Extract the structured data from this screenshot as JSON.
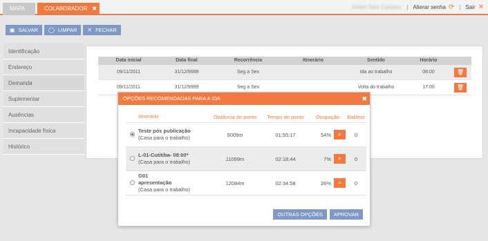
{
  "tabs": [
    {
      "label": "MAPA"
    },
    {
      "label": "COLABORADOR",
      "close": "✖"
    }
  ],
  "user": {
    "name": "André Reis Cardoso",
    "change_password": "Alterar senha",
    "exit": "Sair"
  },
  "toolbar": {
    "save": "SALVAR",
    "clear": "LIMPAR",
    "close": "FECHAR"
  },
  "sidebar": {
    "items": [
      {
        "label": "Identificação"
      },
      {
        "label": "Endereço"
      },
      {
        "label": "Demanda"
      },
      {
        "label": "Suplementar"
      },
      {
        "label": "Ausências"
      },
      {
        "label": "Incapacidade física"
      },
      {
        "label": "Histórico"
      }
    ]
  },
  "grid": {
    "headers": {
      "inicial": "Data inicial",
      "final": "Data final",
      "recorrencia": "Recorrência",
      "itinerario": "Itinerário",
      "sentido": "Sentido",
      "horario": "Horário"
    },
    "rows": [
      {
        "inicial": "09/11/2011",
        "final": "31/12/9999",
        "recorrencia": "Seg a Sex",
        "itinerario": "",
        "sentido": "Ida ao trabalho",
        "horario": "08:00"
      },
      {
        "inicial": "09/11/2011",
        "final": "31/12/9999",
        "recorrencia": "Seg a Sex",
        "itinerario": "",
        "sentido": "Volta do trabalho",
        "horario": "17:00"
      }
    ]
  },
  "modal": {
    "title": "OPÇÕES RECOMENDADAS PARA A IDA",
    "headers": {
      "itinerario": "Itinerário",
      "distancia": "Distância do ponto",
      "tempo": "Tempo do ponto",
      "ocupacao": "Ocupação",
      "baldeio": "Baldeio"
    },
    "rows": [
      {
        "name": "Teste pós publicação",
        "sub": "(Casa para o trabalho)",
        "distancia": "9009m",
        "tempo": "01:55:17",
        "ocupacao": "54%",
        "baldeio": "0",
        "selected": true
      },
      {
        "name": "L-01-Cutitiba- 08:00*",
        "sub": "(Casa para o trabalho)",
        "distancia": "11099m",
        "tempo": "02:18:44",
        "ocupacao": "7%",
        "baldeio": "0",
        "selected": false
      },
      {
        "name": "G01\napresentação",
        "sub": "(Casa para o trabalho)",
        "distancia": "12084m",
        "tempo": "02:34:58",
        "ocupacao": "26%",
        "baldeio": "0",
        "selected": false
      }
    ],
    "buttons": {
      "other": "OUTRAS OPÇÕES",
      "approve": "APROVAR"
    }
  },
  "colors": {
    "accent": "#f07a3f",
    "button": "#7f99c4"
  }
}
